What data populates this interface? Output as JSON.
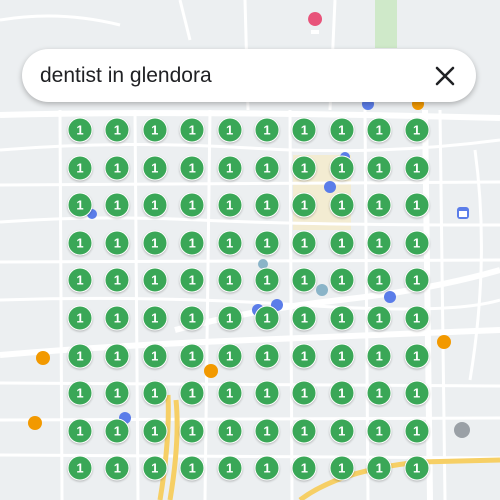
{
  "search": {
    "query": "dentist in glendora",
    "close_icon": "close-icon"
  },
  "pin_grid": {
    "rows": 10,
    "columns": 10,
    "labels": [
      [
        "1",
        "1",
        "1",
        "1",
        "1",
        "1",
        "1",
        "1",
        "1",
        "1"
      ],
      [
        "1",
        "1",
        "1",
        "1",
        "1",
        "1",
        "1",
        "1",
        "1",
        "1"
      ],
      [
        "1",
        "1",
        "1",
        "1",
        "1",
        "1",
        "1",
        "1",
        "1",
        "1"
      ],
      [
        "1",
        "1",
        "1",
        "1",
        "1",
        "1",
        "1",
        "1",
        "1",
        "1"
      ],
      [
        "1",
        "1",
        "1",
        "1",
        "1",
        "1",
        "1",
        "1",
        "1",
        "1"
      ],
      [
        "1",
        "1",
        "1",
        "1",
        "1",
        "1",
        "1",
        "1",
        "1",
        "1"
      ],
      [
        "1",
        "1",
        "1",
        "1",
        "1",
        "1",
        "1",
        "1",
        "1",
        "1"
      ],
      [
        "1",
        "1",
        "1",
        "1",
        "1",
        "1",
        "1",
        "1",
        "1",
        "1"
      ],
      [
        "1",
        "1",
        "1",
        "1",
        "1",
        "1",
        "1",
        "1",
        "1",
        "1"
      ],
      [
        "1",
        "1",
        "1",
        "1",
        "1",
        "1",
        "1",
        "1",
        "1",
        "1"
      ]
    ],
    "color": "#3aa757"
  },
  "poi_icons": [
    {
      "name": "hotel-icon",
      "color": "#e8537a"
    },
    {
      "name": "shopping-icon",
      "color": "#5b7de9"
    },
    {
      "name": "restaurant-icon",
      "color": "#f29900"
    },
    {
      "name": "transit-icon",
      "color": "#8ab4c8"
    },
    {
      "name": "place-of-worship-icon",
      "color": "#9aa0a6"
    }
  ],
  "colors": {
    "map_background": "#eceff1",
    "road": "#ffffff",
    "highway": "#f6cf65",
    "park": "#cfe9c9",
    "search_bar": "#ffffff"
  }
}
